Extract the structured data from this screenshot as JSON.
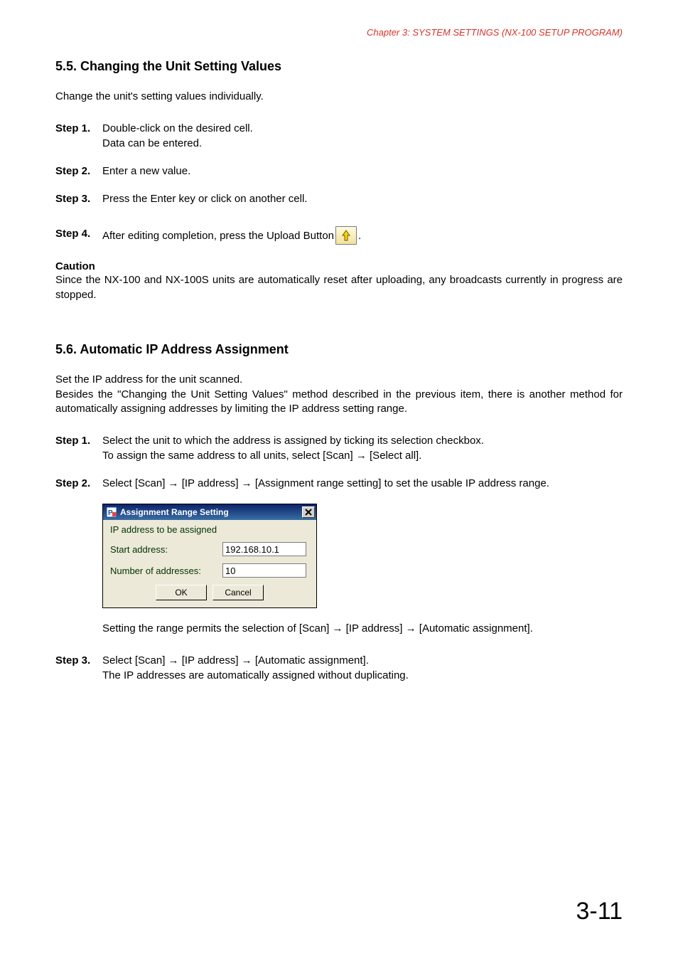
{
  "chapterHeader": "Chapter 3:  SYSTEM SETTINGS (NX-100 SETUP PROGRAM)",
  "section55": {
    "heading": "5.5. Changing the Unit Setting Values",
    "intro": "Change the unit's setting values individually.",
    "steps": {
      "s1": {
        "label": "Step 1.",
        "line1": "Double-click on the desired cell.",
        "line2": "Data can be entered."
      },
      "s2": {
        "label": "Step 2.",
        "line1": "Enter a new value."
      },
      "s3": {
        "label": "Step 3.",
        "line1": "Press the Enter key or click on another cell."
      },
      "s4": {
        "label": "Step 4.",
        "before": "After editing completion, press the Upload Button ",
        "after": "."
      }
    },
    "cautionHeading": "Caution",
    "cautionText": "Since the NX-100 and NX-100S units are automatically reset after uploading, any broadcasts currently in progress are stopped."
  },
  "section56": {
    "heading": "5.6. Automatic IP Address Assignment",
    "intro1": "Set the IP address for the unit scanned.",
    "intro2": "Besides the \"Changing the Unit Setting Values\" method described in the previous item, there is another method for automatically assigning addresses by limiting the IP address setting range.",
    "steps": {
      "s1": {
        "label": "Step 1.",
        "line1": "Select the unit to which the address is assigned by ticking its selection checkbox.",
        "line2": "To assign the same address to all units, select [Scan] → [Select all]."
      },
      "s2": {
        "label": "Step 2.",
        "line1": "Select [Scan] → [IP address] → [Assignment range setting] to set the usable IP address range."
      },
      "afterDialog": "Setting the range permits the selection of [Scan] → [IP address] → [Automatic assignment].",
      "s3": {
        "label": "Step 3.",
        "line1": "Select [Scan] → [IP address] → [Automatic assignment].",
        "line2": "The IP addresses are automatically assigned without duplicating."
      }
    }
  },
  "dialog": {
    "title": "Assignment Range Setting",
    "subhead": "IP address to be assigned",
    "startLabel": "Start address:",
    "startValue": "192.168.10.1",
    "numLabel": "Number of addresses:",
    "numValue": "10",
    "okLabel": "OK",
    "cancelLabel": "Cancel"
  },
  "pageNumber": "3-11"
}
